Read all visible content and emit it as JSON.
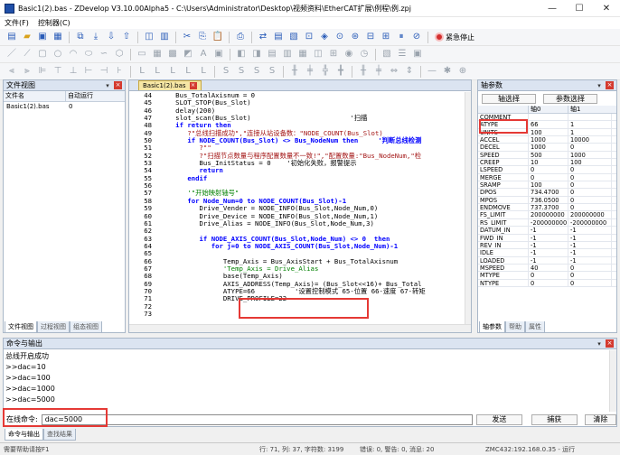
{
  "window": {
    "title": "Basic1(2).bas - ZDevelop V3.10.00Alpha5 - C:\\Users\\Administrator\\Desktop\\视频资料\\EtherCAT扩展\\例程\\例.zpj",
    "minimize": "—",
    "maximize": "☐",
    "close": "✕"
  },
  "menu": [
    "文件(F)",
    "控制器(C)"
  ],
  "toolbar": {
    "emergency_stop": "紧急停止"
  },
  "file_view": {
    "title": "文件视图",
    "col_file": "文件名",
    "col_auto": "自动运行",
    "files": [
      {
        "name": "Basic1(2).bas",
        "auto": "0"
      }
    ],
    "tabs": [
      "文件视图",
      "过程视图",
      "组态视图"
    ]
  },
  "editor": {
    "tab": "Basic1(2).bas",
    "lines": [
      {
        "n": "44",
        "t": "   Bus_TotalAxisnum = 0"
      },
      {
        "n": "45",
        "t": "   SLOT_STOP(Bus_Slot)"
      },
      {
        "n": "46",
        "t": "   delay(200)"
      },
      {
        "n": "47",
        "t": "   slot_scan(Bus_Slot)                         '扫描"
      },
      {
        "n": "48",
        "t": "   if return then"
      },
      {
        "n": "49",
        "t": "      ?\"总线扫描成功\",\"连接从站设备数：\"NODE_COUNT(Bus_Slot)"
      },
      {
        "n": "50",
        "t": "      if NODE_COUNT(Bus_Slot) <> Bus_NodeNum then     '判断总线检测"
      },
      {
        "n": "51",
        "t": "         ?\"\""
      },
      {
        "n": "52",
        "t": "         ?\"扫描节点数量与程序配置数量不一致!\",\"配置数量:\"Bus_NodeNum,\"检"
      },
      {
        "n": "53",
        "t": "         Bus_InitStatus = 0    '初始化失败，报警提示"
      },
      {
        "n": "54",
        "t": "         return"
      },
      {
        "n": "55",
        "t": "      endif"
      },
      {
        "n": "56",
        "t": ""
      },
      {
        "n": "57",
        "t": "      '\"开始映射轴号\""
      },
      {
        "n": "58",
        "t": "      for Node_Num=0 to NODE_COUNT(Bus_Slot)-1"
      },
      {
        "n": "59",
        "t": "         Drive_Vender = NODE_INFO(Bus_Slot,Node_Num,0)"
      },
      {
        "n": "60",
        "t": "         Drive_Device = NODE_INFO(Bus_Slot,Node_Num,1)"
      },
      {
        "n": "61",
        "t": "         Drive_Alias = NODE_INFO(Bus_Slot,Node_Num,3)"
      },
      {
        "n": "62",
        "t": ""
      },
      {
        "n": "63",
        "t": "         if NODE_AXIS_COUNT(Bus_Slot,Node_Num) <> 0  then"
      },
      {
        "n": "64",
        "t": "            for j=0 to NODE_AXIS_COUNT(Bus_Slot,Node_Num)-1"
      },
      {
        "n": "65",
        "t": ""
      },
      {
        "n": "66",
        "t": "               Temp_Axis = Bus_AxisStart + Bus_TotalAxisnum"
      },
      {
        "n": "67",
        "t": "               'Temp_Axis = Drive_Alias"
      },
      {
        "n": "68",
        "t": "               base(Temp_Axis)"
      },
      {
        "n": "69",
        "t": "               AXIS_ADDRESS(Temp_Axis)= (Bus_Slot<<16)+ Bus_Total"
      },
      {
        "n": "70",
        "t": "               ATYPE=66          '设置控制模式 65-位置 66-速度 67-转矩"
      },
      {
        "n": "71",
        "t": "               DRIVE_PROFILE=22"
      },
      {
        "n": "72",
        "t": ""
      },
      {
        "n": "73",
        "t": ""
      }
    ]
  },
  "axis_params": {
    "title": "轴参数",
    "btn_axis_select": "轴选择",
    "btn_param_select": "参数选择",
    "col_axis0": "轴0",
    "col_axis1": "轴1",
    "rows": [
      {
        "k": "COMMENT",
        "a": "",
        "b": ""
      },
      {
        "k": "ATYPE",
        "a": "66",
        "b": "1"
      },
      {
        "k": "UNITS",
        "a": "100",
        "b": "1"
      },
      {
        "k": "ACCEL",
        "a": "1000",
        "b": "10000"
      },
      {
        "k": "DECEL",
        "a": "1000",
        "b": "0"
      },
      {
        "k": "SPEED",
        "a": "500",
        "b": "1000"
      },
      {
        "k": "CREEP",
        "a": "10",
        "b": "100"
      },
      {
        "k": "LSPEED",
        "a": "0",
        "b": "0"
      },
      {
        "k": "MERGE",
        "a": "0",
        "b": "0"
      },
      {
        "k": "SRAMP",
        "a": "100",
        "b": "0"
      },
      {
        "k": "DPOS",
        "a": "734.4700",
        "b": "0"
      },
      {
        "k": "MPOS",
        "a": "736.0500",
        "b": "0"
      },
      {
        "k": "ENDMOVE",
        "a": "737.3700",
        "b": "0"
      },
      {
        "k": "FS_LIMIT",
        "a": "200000000",
        "b": "200000000"
      },
      {
        "k": "RS_LIMIT",
        "a": "-200000000",
        "b": "-200000000"
      },
      {
        "k": "DATUM_IN",
        "a": "-1",
        "b": "-1"
      },
      {
        "k": "FWD_IN",
        "a": "-1",
        "b": "-1"
      },
      {
        "k": "REV_IN",
        "a": "-1",
        "b": "-1"
      },
      {
        "k": "IDLE",
        "a": "-1",
        "b": "-1"
      },
      {
        "k": "LOADED",
        "a": "-1",
        "b": "-1"
      },
      {
        "k": "MSPEED",
        "a": "40",
        "b": "0"
      },
      {
        "k": "MTYPE",
        "a": "0",
        "b": "0"
      },
      {
        "k": "NTYPE",
        "a": "0",
        "b": "0"
      }
    ],
    "tabs": [
      "轴参数",
      "帮助",
      "属性"
    ]
  },
  "console": {
    "title": "命令与输出",
    "lines": [
      "总线开启成功",
      ">>dac=10",
      ">>dac=100",
      ">>dac=1000",
      ">>dac=5000"
    ],
    "online_label": "在线命令:",
    "command_value": "dac=5000",
    "send": "发送",
    "capture": "捕获",
    "clear": "清除",
    "tabs": [
      "命令与输出",
      "查找结果"
    ]
  },
  "statusbar": {
    "help": "需要帮助请按F1",
    "pos": "行: 71, 列: 37, 字符数: 3199",
    "errors": "错误: 0, 警告: 0, 消息: 20",
    "controller": "ZMC432:192.168.0.35 - 运行"
  }
}
